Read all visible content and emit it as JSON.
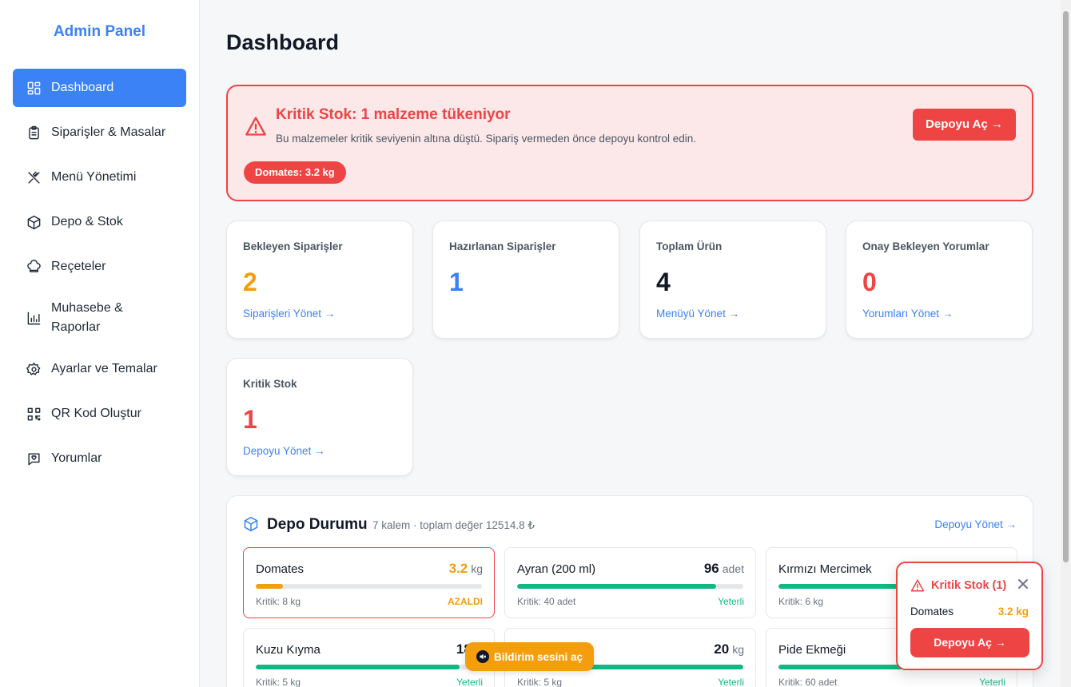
{
  "sidebar": {
    "brand": "Admin Panel",
    "items": [
      {
        "label": "Dashboard",
        "icon": "grid-icon",
        "active": true
      },
      {
        "label": "Siparişler & Masalar",
        "icon": "clipboard-icon"
      },
      {
        "label": "Menü Yönetimi",
        "icon": "utensils-icon"
      },
      {
        "label": "Depo & Stok",
        "icon": "box-icon"
      },
      {
        "label": "Reçeteler",
        "icon": "chef-hat-icon"
      },
      {
        "label": "Muhasebe & Raporlar",
        "icon": "bar-chart-icon"
      },
      {
        "label": "Ayarlar ve Temalar",
        "icon": "gear-icon"
      },
      {
        "label": "QR Kod Oluştur",
        "icon": "qr-code-icon"
      },
      {
        "label": "Yorumlar",
        "icon": "message-icon"
      }
    ]
  },
  "page": {
    "title": "Dashboard"
  },
  "alert": {
    "title": "Kritik Stok: 1 malzeme tükeniyor",
    "description": "Bu malzemeler kritik seviyenin altına düştü. Sipariş vermeden önce depoyu kontrol edin.",
    "pill": "Domates: 3.2 kg",
    "button": "Depoyu Aç →",
    "color": "#ef4444"
  },
  "stats": [
    {
      "label": "Bekleyen Siparişler",
      "value": "2",
      "link": "Siparişleri Yönet →",
      "color": "#f59e0b"
    },
    {
      "label": "Hazırlanan Siparişler",
      "value": "1",
      "link": "",
      "color": "#3b82f6"
    },
    {
      "label": "Toplam Ürün",
      "value": "4",
      "link": "Menüyü Yönet →",
      "color": "#111827"
    },
    {
      "label": "Onay Bekleyen Yorumlar",
      "value": "0",
      "link": "Yorumları Yönet →",
      "color": "#ef4444"
    },
    {
      "label": "Kritik Stok",
      "value": "1",
      "link": "Depoyu Yönet →",
      "color": "#ef4444"
    }
  ],
  "depot": {
    "title": "Depo Durumu",
    "meta": "7 kalem · toplam değer 12514.8 ₺",
    "link": "Depoyu Yönet →",
    "items": [
      {
        "name": "Domates",
        "qty": "3.2",
        "unit": "kg",
        "critical_label": "Kritik: 8 kg",
        "status": "AZALDI",
        "level": 0.12,
        "critical": true
      },
      {
        "name": "Ayran (200 ml)",
        "qty": "96",
        "unit": "adet",
        "critical_label": "Kritik: 40 adet",
        "status": "Yeterli",
        "level": 0.88,
        "critical": false
      },
      {
        "name": "Kırmızı Mercimek",
        "qty": "",
        "unit": "",
        "critical_label": "Kritik: 6 kg",
        "status": "",
        "level": 0.6,
        "critical": false
      },
      {
        "name": "Kuzu Kıyma",
        "qty": "18.5",
        "unit": "",
        "critical_label": "Kritik: 5 kg",
        "status": "Yeterli",
        "level": 0.9,
        "critical": false
      },
      {
        "name": "",
        "qty": "20",
        "unit": "kg",
        "critical_label": "Kritik: 5 kg",
        "status": "Yeterli",
        "level": 1.0,
        "critical": false
      },
      {
        "name": "Pide Ekmeği",
        "qty": "",
        "unit": "",
        "critical_label": "Kritik: 60 adet",
        "status": "Yeterli",
        "level": 0.6,
        "critical": false
      }
    ]
  },
  "sound_button": {
    "label": "Bildirim sesini aç",
    "icon": "speaker-mute-icon"
  },
  "toast": {
    "title": "Kritik Stok (1)",
    "item_name": "Domates",
    "item_qty": "3.2 kg",
    "button": "Depoyu Aç →"
  }
}
